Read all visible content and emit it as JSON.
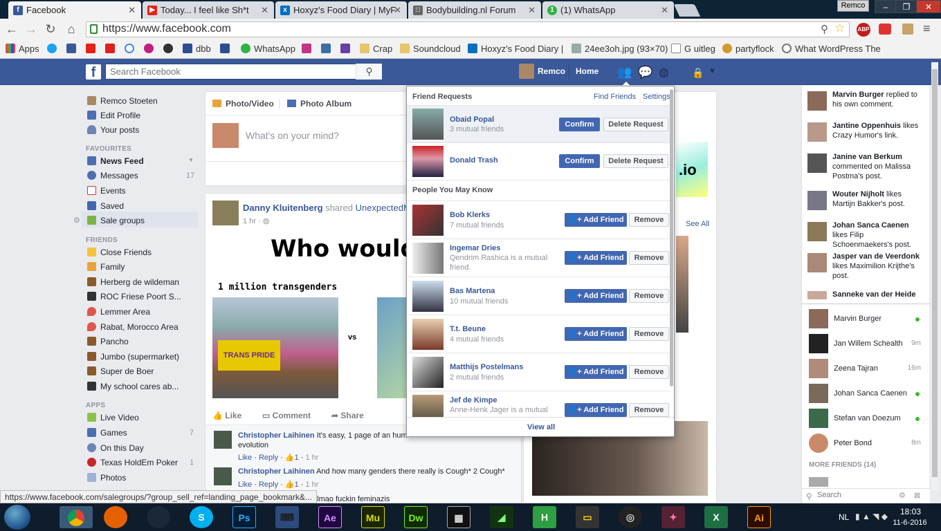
{
  "browser": {
    "tabs": [
      {
        "title": "Facebook",
        "icon": "facebook-icon",
        "color": "#3b5998",
        "active": true
      },
      {
        "title": "Today... I feel like Sh*t",
        "icon": "youtube-icon",
        "color": "#e62117"
      },
      {
        "title": "Hoxyz's Food Diary | MyF",
        "icon": "myfitnesspal-icon",
        "color": "#0070bf"
      },
      {
        "title": "Bodybuilding.nl Forum",
        "icon": "page-icon",
        "color": "#555555"
      },
      {
        "title": "(1) WhatsApp",
        "icon": "whatsapp-icon",
        "color": "#2fb344"
      }
    ],
    "profile_user": "Remco",
    "url": "https://www.facebook.com",
    "bookmarks": [
      "Apps",
      "",
      "",
      "",
      "",
      "",
      "",
      "",
      "",
      "dbb",
      "",
      "WhatsApp",
      "",
      "",
      "",
      "Crap",
      "Soundcloud",
      "Hoxyz's Food Diary | ",
      "24ee3oh.jpg (93×70)",
      "G uitleg",
      "partyflock",
      "What WordPress The"
    ],
    "status_url": "https://www.facebook.com/salegroups/?group_sell_ref=landing_page_bookmark&..."
  },
  "fb": {
    "search_placeholder": "Search Facebook",
    "user_name": "Remco",
    "home_label": "Home",
    "left_nav": {
      "profile": "Remco Stoeten",
      "edit_profile": "Edit Profile",
      "your_posts": "Your posts",
      "favourites_heading": "FAVOURITES",
      "favourites": [
        {
          "label": "News Feed",
          "count": ""
        },
        {
          "label": "Messages",
          "count": "17"
        },
        {
          "label": "Events",
          "count": ""
        },
        {
          "label": "Saved",
          "count": ""
        },
        {
          "label": "Sale groups",
          "count": ""
        }
      ],
      "friends_heading": "FRIENDS",
      "friends": [
        "Close Friends",
        "Family",
        "Herberg de wildeman",
        "ROC Friese Poort S...",
        "Lemmer Area",
        "Rabat, Morocco Area",
        "Pancho",
        "Jumbo (supermarket)",
        "Super de Boer",
        "My school cares ab..."
      ],
      "apps_heading": "APPS",
      "apps": [
        {
          "label": "Live Video",
          "count": ""
        },
        {
          "label": "Games",
          "count": "7"
        },
        {
          "label": "On this Day",
          "count": ""
        },
        {
          "label": "Texas HoldEm Poker",
          "count": "1"
        },
        {
          "label": "Photos",
          "count": ""
        }
      ]
    },
    "composer": {
      "photo_video": "Photo/Video",
      "photo_album": "Photo Album",
      "placeholder": "What's on your mind?"
    },
    "post": {
      "author": "Danny Kluitenberg",
      "action": "shared",
      "shared_from": "UnexpectedM",
      "time": "1 hr",
      "meme_title": "Who would w",
      "meme_left": "1 million transgenders",
      "meme_vs": "vs",
      "meme_sign": "TRANS PRIDE",
      "like": "Like",
      "comment": "Comment",
      "share": "Share",
      "comments": [
        {
          "author": "Christopher Laihinen",
          "text": "It's easy, 1 page of an hum",
          "text2": "evolution",
          "likes": "1",
          "time": "1 hr"
        },
        {
          "author": "Christopher Laihinen",
          "text": "And how many genders there really is Cough* 2 Cough*",
          "likes": "1",
          "time": "1 hr"
        }
      ],
      "comment_like": "Like",
      "comment_reply": "Reply",
      "partial_comment": "h lmao fuckin feminazis"
    },
    "right_card": {
      "io_text": ".io",
      "see_all": "See All"
    },
    "friend_popup": {
      "title": "Friend Requests",
      "find_friends": "Find Friends",
      "settings": "Settings",
      "requests": [
        {
          "name": "Obaid Popal",
          "sub": "3 mutual friends"
        },
        {
          "name": "Donald Trash",
          "sub": ""
        }
      ],
      "confirm_label": "Confirm",
      "delete_label": "Delete Request",
      "pymk_title": "People You May Know",
      "pymk": [
        {
          "name": "Bob Klerks",
          "sub": "7 mutual friends"
        },
        {
          "name": "Ingemar Dries",
          "sub": "Qendrim Rashica is a mutual friend."
        },
        {
          "name": "Bas Martena",
          "sub": "10 mutual friends"
        },
        {
          "name": "T.t. Beune",
          "sub": "4 mutual friends"
        },
        {
          "name": "Matthijs Postelmans",
          "sub": "2 mutual friends"
        },
        {
          "name": "Jef de Kimpe",
          "sub": "Anne-Henk Jager is a mutual"
        }
      ],
      "add_label": "Add Friend",
      "remove_label": "Remove",
      "view_all": "View all"
    },
    "ticker": [
      {
        "name": "Marvin Burger",
        "text": "replied to his own comment."
      },
      {
        "name": "Jantine Oppenhuis",
        "text": "likes Crazy Humor's link."
      },
      {
        "name": "Janine van Berkum",
        "text": "commented on Malissa Postma's post."
      },
      {
        "name": "Wouter Nijholt",
        "text": "likes Martijn Bakker's post."
      },
      {
        "name": "Johan Sanca Caenen",
        "text": "likes Filip Schoenmaekers's post."
      },
      {
        "name": "Jasper van de Veerdonk",
        "text": "likes Maximilion Krijthe's post."
      },
      {
        "name": "Sanneke van der Heide",
        "text": ""
      }
    ],
    "chat": [
      {
        "name": "Marvin Burger",
        "status": "online",
        "time": ""
      },
      {
        "name": "Jan Willem Schealth",
        "status": "idle",
        "time": "9m"
      },
      {
        "name": "Zeena Tajran",
        "status": "idle",
        "time": "16m"
      },
      {
        "name": "Johan Sanca Caenen",
        "status": "online",
        "time": ""
      },
      {
        "name": "Stefan van Doezum",
        "status": "online",
        "time": ""
      },
      {
        "name": "Peter Bond",
        "status": "idle",
        "time": "8m"
      }
    ],
    "more_friends": "MORE FRIENDS (14)",
    "chat_search_placeholder": "Search"
  },
  "taskbar": {
    "language": "NL",
    "time": "18:03",
    "date": "11-6-2016",
    "apps": [
      {
        "name": "chrome",
        "label": "",
        "color": "#3a8f3a"
      },
      {
        "name": "firefox",
        "label": "",
        "color": "#e66000"
      },
      {
        "name": "steam",
        "label": "",
        "color": "#1b2838"
      },
      {
        "name": "skype",
        "label": "S",
        "color": "#00aff0"
      },
      {
        "name": "photoshop",
        "label": "Ps",
        "color": "#001d34"
      },
      {
        "name": "keyboard",
        "label": "",
        "color": "#2d4a7a"
      },
      {
        "name": "after-effects",
        "label": "Ae",
        "color": "#1f0740"
      },
      {
        "name": "muse",
        "label": "Mu",
        "color": "#1c2400"
      },
      {
        "name": "dreamweaver",
        "label": "Dw",
        "color": "#0f2a00"
      },
      {
        "name": "video",
        "label": "",
        "color": "#111111"
      },
      {
        "name": "app",
        "label": "",
        "color": "#113311"
      },
      {
        "name": "hype",
        "label": "H",
        "color": "#2ea043"
      },
      {
        "name": "app2",
        "label": "",
        "color": "#333333"
      },
      {
        "name": "app3",
        "label": "",
        "color": "#222222"
      },
      {
        "name": "app4",
        "label": "",
        "color": "#552233"
      },
      {
        "name": "excel",
        "label": "X",
        "color": "#1d6f42"
      },
      {
        "name": "illustrator",
        "label": "Ai",
        "color": "#2b0d00"
      }
    ]
  }
}
